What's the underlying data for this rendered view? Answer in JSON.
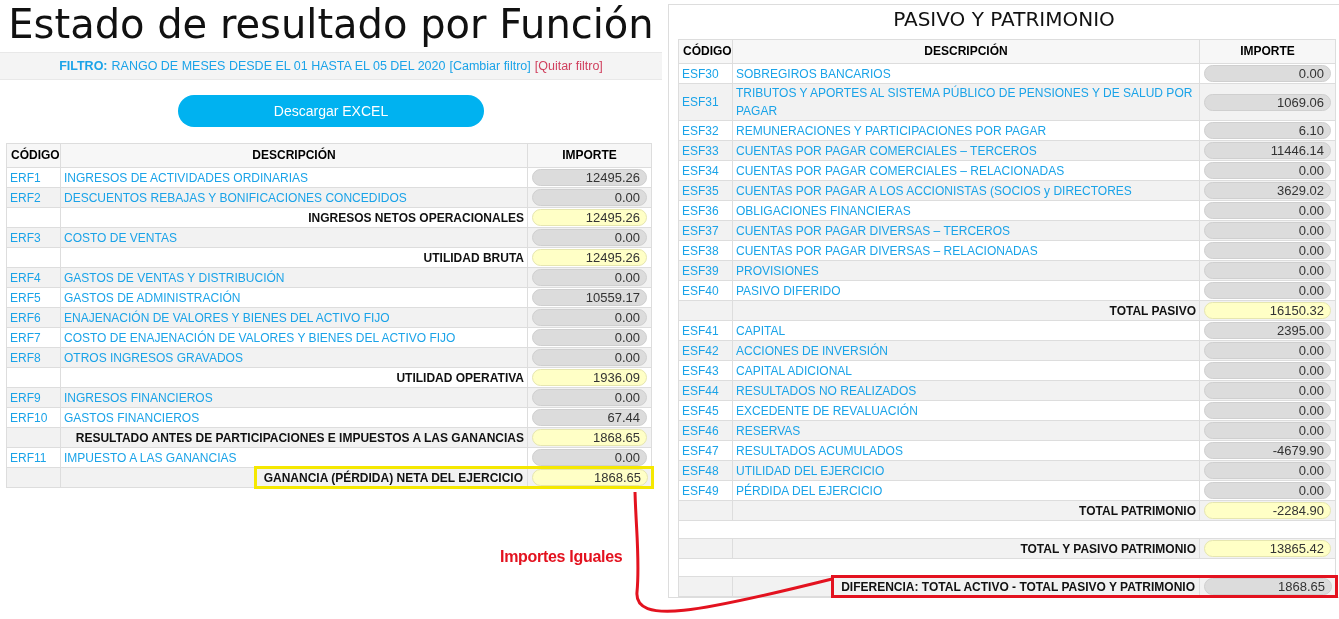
{
  "left": {
    "title": "Estado de resultado por Función",
    "filter": {
      "label": "FILTRO:",
      "text": "RANGO DE MESES DESDE EL 01 HASTA EL 05 DEL 2020",
      "change_link": "[Cambiar filtro]",
      "remove_link": "[Quitar filtro]"
    },
    "download_button": "Descargar EXCEL",
    "table": {
      "columns": [
        "CÓDIGO",
        "DESCRIPCIÓN",
        "IMPORTE"
      ],
      "rows": [
        {
          "kind": "item",
          "code": "ERF1",
          "description": "INGRESOS DE ACTIVIDADES ORDINARIAS",
          "amount": "12495.26"
        },
        {
          "kind": "item",
          "code": "ERF2",
          "description": "DESCUENTOS REBAJAS Y BONIFICACIONES CONCEDIDOS",
          "amount": "0.00"
        },
        {
          "kind": "total",
          "label": "INGRESOS NETOS OPERACIONALES",
          "amount": "12495.26"
        },
        {
          "kind": "item",
          "code": "ERF3",
          "description": "COSTO DE VENTAS",
          "amount": "0.00"
        },
        {
          "kind": "total",
          "label": "UTILIDAD BRUTA",
          "amount": "12495.26"
        },
        {
          "kind": "item",
          "code": "ERF4",
          "description": "GASTOS DE VENTAS Y DISTRIBUCIÓN",
          "amount": "0.00"
        },
        {
          "kind": "item",
          "code": "ERF5",
          "description": "GASTOS DE ADMINISTRACIÓN",
          "amount": "10559.17"
        },
        {
          "kind": "item",
          "code": "ERF6",
          "description": "ENAJENACIÓN DE VALORES Y BIENES DEL ACTIVO FIJO",
          "amount": "0.00"
        },
        {
          "kind": "item",
          "code": "ERF7",
          "description": "COSTO DE ENAJENACIÓN DE VALORES Y BIENES DEL ACTIVO FIJO",
          "amount": "0.00"
        },
        {
          "kind": "item",
          "code": "ERF8",
          "description": "OTROS INGRESOS GRAVADOS",
          "amount": "0.00"
        },
        {
          "kind": "total",
          "label": "UTILIDAD OPERATIVA",
          "amount": "1936.09"
        },
        {
          "kind": "item",
          "code": "ERF9",
          "description": "INGRESOS FINANCIEROS",
          "amount": "0.00"
        },
        {
          "kind": "item",
          "code": "ERF10",
          "description": "GASTOS FINANCIEROS",
          "amount": "67.44"
        },
        {
          "kind": "total",
          "label": "RESULTADO ANTES DE PARTICIPACIONES E IMPUESTOS A LAS GANANCIAS",
          "amount": "1868.65"
        },
        {
          "kind": "item",
          "code": "ERF11",
          "description": "IMPUESTO A LAS GANANCIAS",
          "amount": "0.00"
        },
        {
          "kind": "total",
          "label": "GANANCIA (PÉRDIDA) NETA DEL EJERCICIO",
          "amount": "1868.65",
          "color": "#f5e800"
        }
      ]
    }
  },
  "right": {
    "title": "PASIVO Y PATRIMONIO",
    "table": {
      "columns": [
        "CÓDIGO",
        "DESCRIPCIÓN",
        "IMPORTE"
      ],
      "rows": [
        {
          "kind": "item",
          "code": "ESF30",
          "description": "SOBREGIROS BANCARIOS",
          "amount": "0.00"
        },
        {
          "kind": "item",
          "code": "ESF31",
          "description": "TRIBUTOS Y APORTES AL SISTEMA PÚBLICO DE PENSIONES Y DE SALUD POR PAGAR",
          "amount": "1069.06"
        },
        {
          "kind": "item",
          "code": "ESF32",
          "description": "REMUNERACIONES Y PARTICIPACIONES POR PAGAR",
          "amount": "6.10"
        },
        {
          "kind": "item",
          "code": "ESF33",
          "description": "CUENTAS POR PAGAR COMERCIALES – TERCEROS",
          "amount": "11446.14"
        },
        {
          "kind": "item",
          "code": "ESF34",
          "description": "CUENTAS POR PAGAR COMERCIALES – RELACIONADAS",
          "amount": "0.00"
        },
        {
          "kind": "item",
          "code": "ESF35",
          "description": "CUENTAS POR PAGAR A LOS ACCIONISTAS (SOCIOS y DIRECTORES",
          "amount": "3629.02"
        },
        {
          "kind": "item",
          "code": "ESF36",
          "description": "OBLIGACIONES FINANCIERAS",
          "amount": "0.00"
        },
        {
          "kind": "item",
          "code": "ESF37",
          "description": "CUENTAS POR PAGAR DIVERSAS – TERCEROS",
          "amount": "0.00"
        },
        {
          "kind": "item",
          "code": "ESF38",
          "description": "CUENTAS POR PAGAR DIVERSAS – RELACIONADAS",
          "amount": "0.00"
        },
        {
          "kind": "item",
          "code": "ESF39",
          "description": "PROVISIONES",
          "amount": "0.00"
        },
        {
          "kind": "item",
          "code": "ESF40",
          "description": "PASIVO DIFERIDO",
          "amount": "0.00"
        },
        {
          "kind": "total",
          "label": "TOTAL PASIVO",
          "amount": "16150.32"
        },
        {
          "kind": "item",
          "code": "ESF41",
          "description": "CAPITAL",
          "amount": "2395.00"
        },
        {
          "kind": "item",
          "code": "ESF42",
          "description": "ACCIONES DE INVERSIÓN",
          "amount": "0.00"
        },
        {
          "kind": "item",
          "code": "ESF43",
          "description": "CAPITAL ADICIONAL",
          "amount": "0.00"
        },
        {
          "kind": "item",
          "code": "ESF44",
          "description": "RESULTADOS NO REALIZADOS",
          "amount": "0.00"
        },
        {
          "kind": "item",
          "code": "ESF45",
          "description": "EXCEDENTE DE REVALUACIÓN",
          "amount": "0.00"
        },
        {
          "kind": "item",
          "code": "ESF46",
          "description": "RESERVAS",
          "amount": "0.00"
        },
        {
          "kind": "item",
          "code": "ESF47",
          "description": "RESULTADOS ACUMULADOS",
          "amount": "-4679.90"
        },
        {
          "kind": "item",
          "code": "ESF48",
          "description": "UTILIDAD DEL EJERCICIO",
          "amount": "0.00"
        },
        {
          "kind": "item",
          "code": "ESF49",
          "description": "PÉRDIDA DEL EJERCICIO",
          "amount": "0.00"
        },
        {
          "kind": "total",
          "label": "TOTAL PATRIMONIO",
          "amount": "-2284.90"
        },
        {
          "kind": "spacer"
        },
        {
          "kind": "total",
          "label": "TOTAL Y PASIVO PATRIMONIO",
          "amount": "13865.42"
        },
        {
          "kind": "spacer"
        },
        {
          "kind": "difference",
          "label": "DIFERENCIA: TOTAL ACTIVO - TOTAL PASIVO Y PATRIMONIO",
          "amount": "1868.65",
          "color": "#e3121f"
        }
      ]
    }
  },
  "annotation": {
    "text": "Importes Iguales"
  }
}
